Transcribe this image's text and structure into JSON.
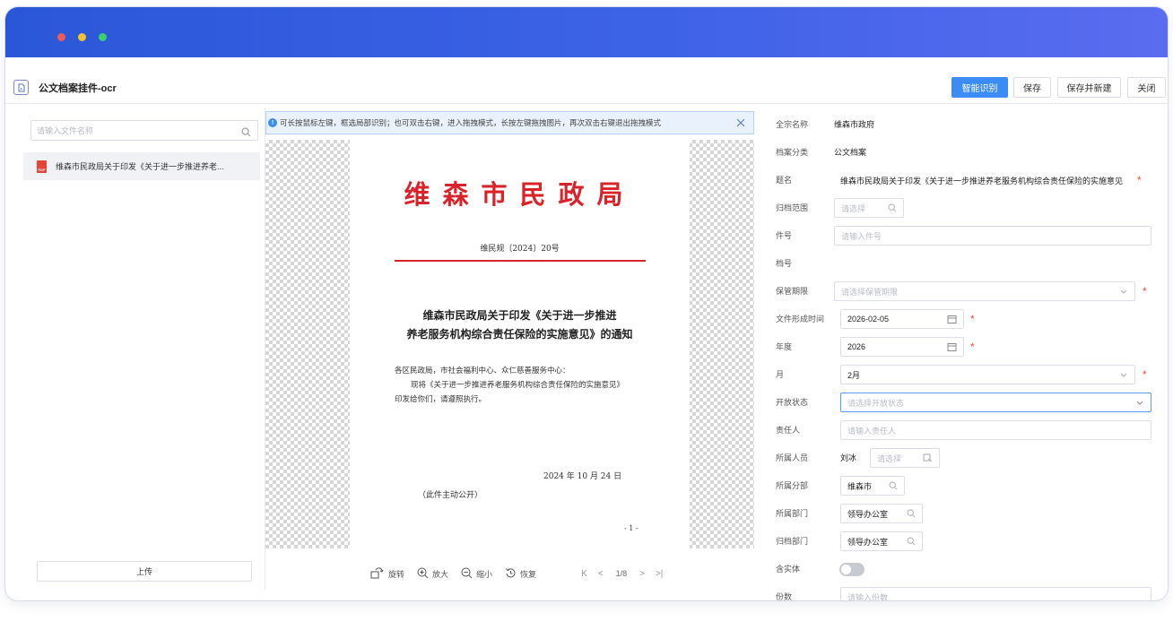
{
  "header": {
    "title": "公文档案挂件-ocr",
    "buttons": {
      "recognize": "智能识别",
      "save": "保存",
      "save_new": "保存并新建",
      "close": "关闭"
    }
  },
  "left": {
    "search_placeholder": "请输入文件名称",
    "file_name": "维森市民政局关于印发《关于进一步推进养老...",
    "file_type": "PDF",
    "upload_label": "上传"
  },
  "viewer": {
    "tip": "可长按鼠标左键，框选局部识别；也可双击右键，进入拖拽模式，长按左键拖拽图片，再次双击右键退出拖拽模式",
    "document": {
      "header": "维森市民政局",
      "number": "维民规〔2024〕20号",
      "title_line1": "维森市民政局关于印发《关于进一步推进",
      "title_line2": "养老服务机构综合责任保险的实施意见》的通知",
      "body_line1": "各区民政局，市社会福利中心、众仁慈善服务中心：",
      "body_line2": "现将《关于进一步推进养老服务机构综合责任保险的实施意见》",
      "body_line3": "印发给你们，请遵照执行。",
      "date": "2024 年 10 月 24 日",
      "note": "（此件主动公开）",
      "page": "- 1 -"
    },
    "toolbar": {
      "rotate": "旋转",
      "zoom_in": "放大",
      "zoom_out": "缩小",
      "restore": "恢复",
      "page_indicator": "1/8"
    }
  },
  "form": {
    "fields": {
      "fonds_name": {
        "label": "全宗名称",
        "value": "维森市政府"
      },
      "archive_category": {
        "label": "档案分类",
        "value": "公文档案"
      },
      "title": {
        "label": "题名",
        "value": "维森市民政局关于印发《关于进一步推进养老服务机构综合责任保险的实施意见"
      },
      "archive_scope": {
        "label": "归档范围",
        "placeholder": "请选择"
      },
      "item_number": {
        "label": "件号",
        "placeholder": "请输入件号"
      },
      "file_number": {
        "label": "档号"
      },
      "retention_period": {
        "label": "保管期限",
        "placeholder": "请选择保管期限"
      },
      "formation_date": {
        "label": "文件形成时间",
        "value": "2026-02-05"
      },
      "year": {
        "label": "年度",
        "value": "2026"
      },
      "month": {
        "label": "月",
        "value": "2月"
      },
      "open_status": {
        "label": "开放状态",
        "placeholder": "请选择开放状态"
      },
      "responsible_person": {
        "label": "责任人",
        "placeholder": "请输入责任人"
      },
      "personnel": {
        "label": "所属人员",
        "value": "刘冰",
        "placeholder": "请选择"
      },
      "branch": {
        "label": "所属分部",
        "value": "维森市"
      },
      "department": {
        "label": "所属部门",
        "value": "领导办公室"
      },
      "archive_department": {
        "label": "归档部门",
        "value": "领导办公室"
      },
      "has_entity": {
        "label": "含实体",
        "enabled": false
      },
      "copies": {
        "label": "份数",
        "placeholder": "请输入份数"
      }
    }
  },
  "colors": {
    "accent": "#3c8cf5",
    "titlebar": "#3d62e6",
    "doc_red": "#d8232a",
    "required": "#f04d3d"
  }
}
